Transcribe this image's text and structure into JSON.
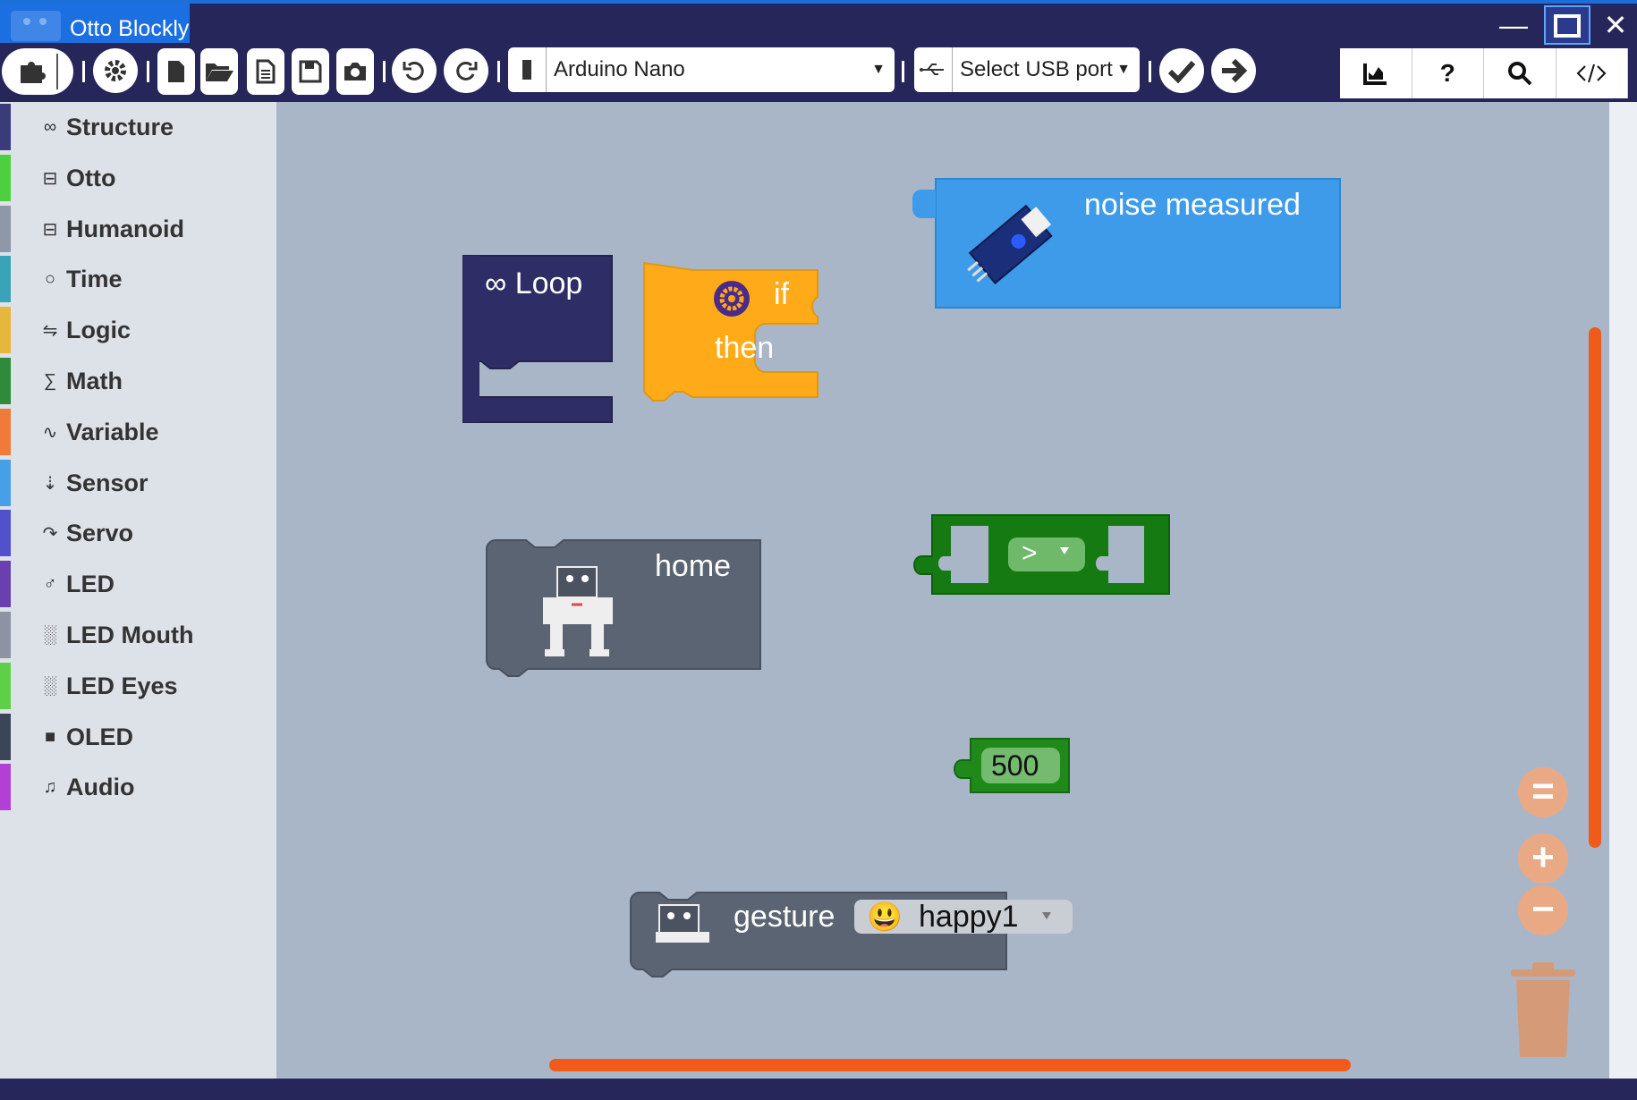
{
  "window": {
    "title": "Otto Blockly",
    "controls": {
      "minimize": "—",
      "close": "✕"
    }
  },
  "toolbar": {
    "board_select": "Arduino Nano",
    "port_select": "Select USB port"
  },
  "sidebar": {
    "items": [
      {
        "label": "Structure",
        "icon": "∞",
        "color": "#3b3b7a"
      },
      {
        "label": "Otto",
        "icon": "⊟",
        "color": "#4dcf3f"
      },
      {
        "label": "Humanoid",
        "icon": "⊟",
        "color": "#8f98a8"
      },
      {
        "label": "Time",
        "icon": "○",
        "color": "#39a3b8"
      },
      {
        "label": "Logic",
        "icon": "⇋",
        "color": "#e6b73a"
      },
      {
        "label": "Math",
        "icon": "∑",
        "color": "#2e8b3a"
      },
      {
        "label": "Variable",
        "icon": "∿",
        "color": "#f07a3a"
      },
      {
        "label": "Sensor",
        "icon": "⇣",
        "color": "#46a0e8"
      },
      {
        "label": "Servo",
        "icon": "↷",
        "color": "#5151cc"
      },
      {
        "label": "LED",
        "icon": "♂",
        "color": "#6a3fb0"
      },
      {
        "label": "LED Mouth",
        "icon": "░",
        "color": "#8d93a3"
      },
      {
        "label": "LED Eyes",
        "icon": "░",
        "color": "#5ed048"
      },
      {
        "label": "OLED",
        "icon": "■",
        "color": "#3a4558"
      },
      {
        "label": "Audio",
        "icon": "♫",
        "color": "#b23fd6"
      }
    ]
  },
  "blocks": {
    "loop": {
      "label": "Loop",
      "icon": "∞",
      "color": "#2e2d66"
    },
    "if_block": {
      "if_label": "if",
      "then_label": "then",
      "color": "#ffab19"
    },
    "noise": {
      "label": "noise measured",
      "color": "#3d9be9"
    },
    "compare": {
      "operator": ">",
      "color": "#157a12"
    },
    "home": {
      "label": "home",
      "color": "#5b6473"
    },
    "number": {
      "value": "500",
      "color": "#1f8a1a"
    },
    "gesture": {
      "label": "gesture",
      "emoji": "😃",
      "value": "happy1",
      "color": "#5b6473"
    }
  },
  "colors": {
    "titlebar": "#26265a",
    "accent": "#1b6fe0",
    "scrollbar": "#f05b1b",
    "workspace": "#a9b6c8"
  }
}
